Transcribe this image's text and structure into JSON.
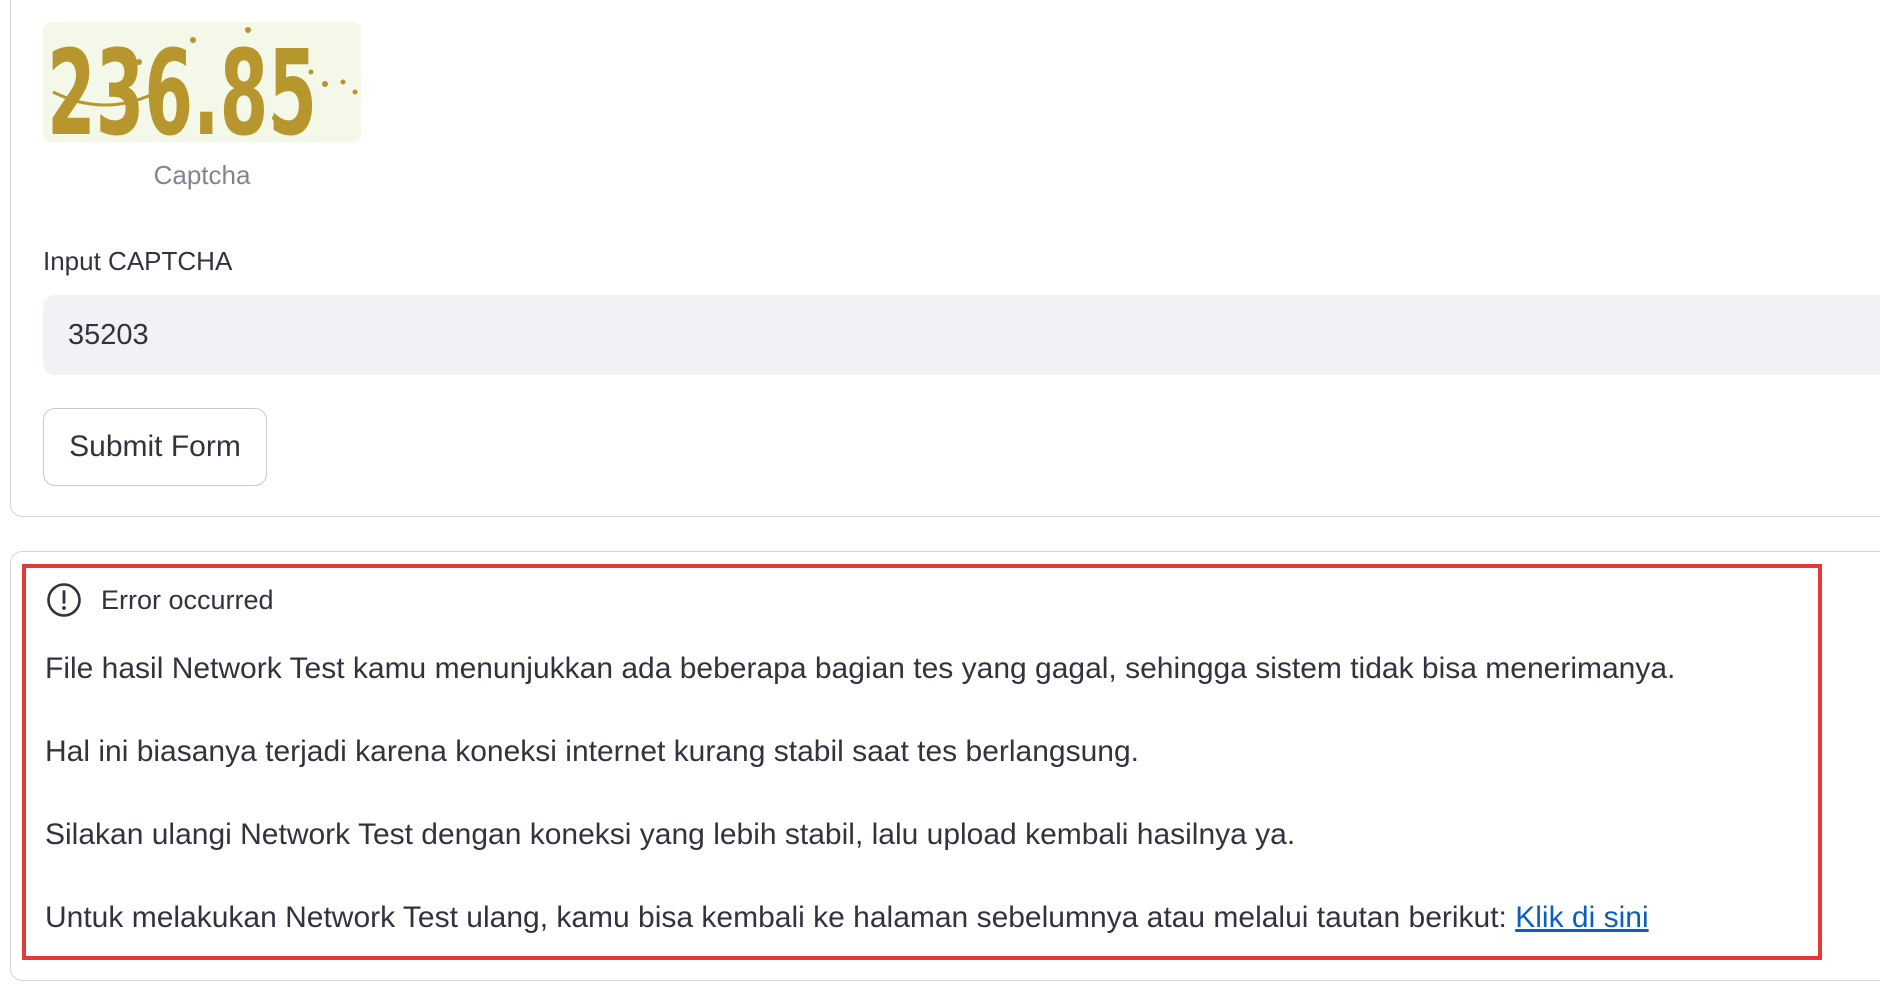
{
  "captcha": {
    "image_text": "236.85",
    "caption": "Captcha"
  },
  "input": {
    "label": "Input CAPTCHA",
    "value": "35203"
  },
  "submit": {
    "label": "Submit Form"
  },
  "error": {
    "icon": "exclamation-circle-icon",
    "title": "Error occurred",
    "paragraphs": [
      "File hasil Network Test kamu menunjukkan ada beberapa bagian tes yang gagal, sehingga sistem tidak bisa menerimanya.",
      "Hal ini biasanya terjadi karena koneksi internet kurang stabil saat tes berlangsung.",
      "Silakan ulangi Network Test dengan koneksi yang lebih stabil, lalu upload kembali hasilnya ya.",
      "Untuk melakukan Network Test ulang, kamu bisa kembali ke halaman sebelumnya atau melalui tautan berikut: "
    ],
    "link_text": "Klik di sini"
  },
  "colors": {
    "highlight": "#e53935",
    "link": "#0b5fbf",
    "captcha_digits": "#b8962e"
  }
}
